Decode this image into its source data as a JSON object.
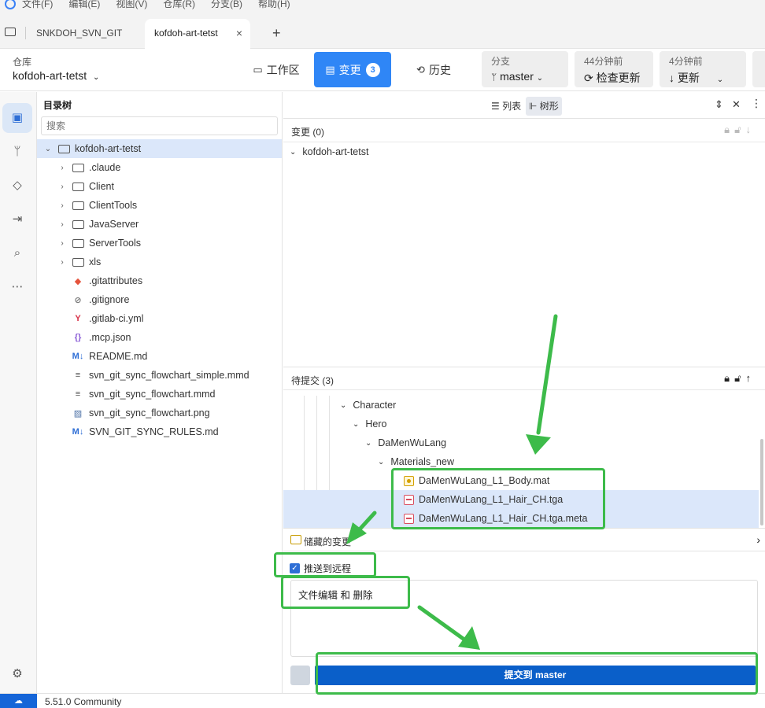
{
  "menu": [
    "文件(F)",
    "编辑(E)",
    "视图(V)",
    "仓库(R)",
    "分支(B)",
    "帮助(H)"
  ],
  "tabs": [
    "SNKDOH_SVN_GIT",
    "kofdoh-art-tetst"
  ],
  "toolbar": {
    "repo_label": "仓库",
    "repo_name": "kofdoh-art-tetst",
    "workspace": "工作区",
    "changes": "变更",
    "changes_count": "3",
    "history": "历史",
    "branch_label": "分支",
    "branch_name": "master",
    "fetch_time": "44分钟前",
    "fetch_label": "检查更新",
    "pull_time": "4分钟前",
    "pull_label": "更新"
  },
  "tree": {
    "header": "目录树",
    "search_placeholder": "搜索",
    "root": "kofdoh-art-tetst",
    "items": [
      {
        "label": ".claude",
        "kind": "folder"
      },
      {
        "label": "Client",
        "kind": "folder"
      },
      {
        "label": "ClientTools",
        "kind": "folder"
      },
      {
        "label": "JavaServer",
        "kind": "folder"
      },
      {
        "label": "ServerTools",
        "kind": "folder"
      },
      {
        "label": "xls",
        "kind": "folder"
      },
      {
        "label": ".gitattributes",
        "kind": "git"
      },
      {
        "label": ".gitignore",
        "kind": "ignore"
      },
      {
        "label": ".gitlab-ci.yml",
        "kind": "yml"
      },
      {
        "label": ".mcp.json",
        "kind": "json"
      },
      {
        "label": "README.md",
        "kind": "md"
      },
      {
        "label": "svn_git_sync_flowchart_simple.mmd",
        "kind": "text"
      },
      {
        "label": "svn_git_sync_flowchart.mmd",
        "kind": "text"
      },
      {
        "label": "svn_git_sync_flowchart.png",
        "kind": "image"
      },
      {
        "label": "SVN_GIT_SYNC_RULES.md",
        "kind": "md"
      }
    ]
  },
  "changes": {
    "view_list": "列表",
    "view_tree": "树形",
    "unstaged_title": "变更 (0)",
    "unstaged_root": "kofdoh-art-tetst",
    "staged_title": "待提交 (3)",
    "staged_tree": [
      "Character",
      "Hero",
      "DaMenWuLang",
      "Materials_new"
    ],
    "staged_files": [
      {
        "name": "DaMenWuLang_L1_Body.mat",
        "status": "modified"
      },
      {
        "name": "DaMenWuLang_L1_Hair_CH.tga",
        "status": "deleted"
      },
      {
        "name": "DaMenWuLang_L1_Hair_CH.tga.meta",
        "status": "deleted"
      }
    ],
    "stash": "储藏的变更",
    "push_remote": "推送到远程",
    "commit_message": "文件编辑 和 删除",
    "commit_button": "提交到 master"
  },
  "status": {
    "version": "5.51.0 Community"
  },
  "colors": {
    "accent": "#2f86f6",
    "commit": "#0a5fc9",
    "annotation": "#3dbb4a"
  }
}
